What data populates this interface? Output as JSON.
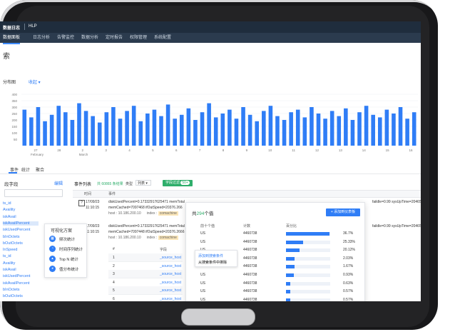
{
  "app": {
    "logo": "数据日志",
    "product": "HLP"
  },
  "nav": [
    "数据面板",
    "日志分析",
    "告警监控",
    "数据分析",
    "定时报告",
    "权限管理",
    "系统配置"
  ],
  "page_title": "索",
  "distribution": {
    "label": "分布图",
    "toggle": "收起 ▾"
  },
  "chart_data": {
    "type": "bar",
    "ytick_labels": [
      "400",
      "350",
      "300",
      "250",
      "200",
      "150",
      "100",
      "50"
    ],
    "xtick_labels": [
      "27",
      "28",
      "2",
      "3",
      "4",
      "5",
      "6",
      "7",
      "8",
      "9",
      "10",
      "11",
      "12",
      "13",
      "14",
      "15",
      "16"
    ],
    "month_labels": [
      "February",
      "March"
    ],
    "values": [
      280,
      220,
      300,
      190,
      240,
      310,
      260,
      200,
      330,
      270,
      230,
      180,
      260,
      300,
      210,
      270,
      310,
      190,
      250,
      280,
      230,
      320,
      210,
      240,
      290,
      200,
      260,
      330,
      220,
      250,
      280,
      210,
      300,
      240,
      190,
      270,
      310,
      230,
      200,
      260,
      280,
      220,
      300,
      250,
      210,
      270,
      230,
      290,
      200,
      260,
      310,
      240,
      220,
      280,
      250,
      300,
      210,
      260
    ],
    "ylim": [
      0,
      400
    ],
    "color": "#2f7df6"
  },
  "tabs": [
    "事件",
    "统计",
    "聚合"
  ],
  "fields": {
    "title": "段字段",
    "edit": "编辑",
    "items": [
      "ts_id",
      "Availity",
      "iskAvail",
      "iskAvailPercent",
      "iskUsedPercent",
      "bInOctets",
      "bOutOctets",
      "InSpeed",
      "ts_id",
      "Availity",
      "iskAvail",
      "iskUsedPercent",
      "iskAvailPercent",
      "bInOctets",
      "bOutOctets",
      "InSpeed",
      "ts_id",
      "Availity",
      "iskAvail"
    ]
  },
  "viz": {
    "title": "可视化方案",
    "items": [
      {
        "icon": "▦",
        "label": "频次统计"
      },
      {
        "icon": "◔",
        "label": "时间序列统计"
      },
      {
        "icon": "▴",
        "label": "Top N 统计"
      },
      {
        "icon": "◕",
        "label": "值分布统计"
      }
    ]
  },
  "events": {
    "title": "事件列表",
    "count": "共 60865 条结果",
    "type_label": "类型",
    "type_value": "列表 ▾",
    "filter": "字段过滤",
    "filter_badge": "50+",
    "head_time": "时间",
    "head_event": "事件",
    "rows": [
      {
        "date": "17/09/23",
        "time": "11:10:15",
        "text": "diskUsedPercent=0.17332917625471  memTotal",
        "line2": "memCached=7097468 ifOutSpeed=20376.266",
        "tail": "faildle=0.99  sysUpTime=204653804",
        "host": "host : 10.186.200.10",
        "index_label": "index : ",
        "index_val": "comachine"
      },
      {
        "date": "17/09/23",
        "time": "11:10:15",
        "text": "diskUsedPercent=0.17332917625471  memTotal",
        "line2": "memCached=7097448 ifOutSpeed=20376.2666",
        "tail": "faildle=0.99  sysUpTime=204653804",
        "host": "host : 10.186.200.10",
        "index_label": "index : ",
        "index_val": "comachine"
      },
      {
        "date": "17/09/23",
        "time": "11:10:15",
        "text": "diskUsedPercent=0.17332917625471  memTotal",
        "line2": "memCached=7097448 ifOutSpeed=20376.26666",
        "tail": "faildle=0.99  sysUpTime=204653804",
        "host": "",
        "index_label": "",
        "index_val": ""
      }
    ]
  },
  "field_table": {
    "head_idx": "#",
    "head_name": "字段",
    "rows": [
      {
        "idx": "1",
        "name": "_source_host"
      },
      {
        "idx": "2",
        "name": "_source_host"
      },
      {
        "idx": "3",
        "name": "_source_host"
      },
      {
        "idx": "4",
        "name": "_source_host"
      },
      {
        "idx": "5",
        "name": "_source_host"
      },
      {
        "idx": "6",
        "name": "_source_host"
      }
    ]
  },
  "context_menu": [
    "添加到搜索条件",
    "从搜索条件中排除"
  ],
  "values_popup": {
    "title_prefix": "共",
    "title_num": "294",
    "title_suffix": "个值",
    "add_button": "+ 添加到仪表板",
    "head_top": "前十个值",
    "head_count": "计数",
    "head_pct": "百分比",
    "rows": [
      {
        "name": "US",
        "count": "4460738",
        "pct_text": "36.7%",
        "pct": 0.98
      },
      {
        "name": "US",
        "count": "4460738",
        "pct_text": "25.33%",
        "pct": 0.38
      },
      {
        "name": "US",
        "count": "4460738",
        "pct_text": "20.12%",
        "pct": 0.3
      },
      {
        "name": "US",
        "count": "4460738",
        "pct_text": "2.03%",
        "pct": 0.2
      },
      {
        "name": "US",
        "count": "4460738",
        "pct_text": "1.67%",
        "pct": 0.2
      },
      {
        "name": "US",
        "count": "4460738",
        "pct_text": "0.93%",
        "pct": 0.18
      },
      {
        "name": "US",
        "count": "4460738",
        "pct_text": "0.63%",
        "pct": 0.1
      },
      {
        "name": "US",
        "count": "4460738",
        "pct_text": "0.57%",
        "pct": 0.1
      },
      {
        "name": "US",
        "count": "4460738",
        "pct_text": "0.57%",
        "pct": 0.1
      },
      {
        "name": "US",
        "count": "4460738",
        "pct_text": "0.57%",
        "pct": 0.1
      }
    ]
  }
}
